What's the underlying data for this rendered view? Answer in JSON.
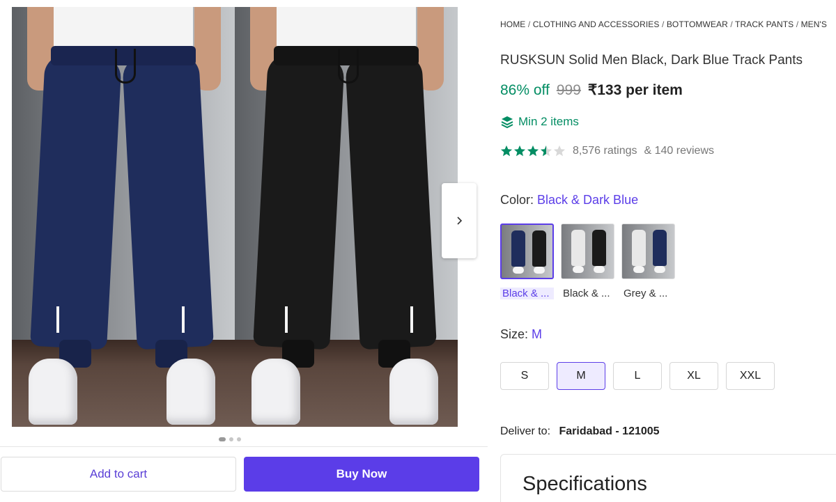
{
  "breadcrumb": {
    "items": [
      "HOME",
      "CLOTHING AND ACCESSORIES",
      "BOTTOMWEAR",
      "TRACK PANTS",
      "MEN'S"
    ],
    "separator": "/"
  },
  "product": {
    "title": "RUSKSUN Solid Men Black, Dark Blue Track Pants",
    "discount": "86% off",
    "mrp": "999",
    "price": "₹133 per item",
    "min_items": "Min 2 items",
    "rating_value": 3.5,
    "ratings": "8,576 ratings",
    "reviews": "& 140 reviews"
  },
  "color": {
    "label": "Color:",
    "selected": "Black & Dark Blue",
    "options": [
      {
        "label": "Black & ...",
        "leg1": "#1f2d5c",
        "leg2": "#1a1a1a"
      },
      {
        "label": "Black & ...",
        "leg1": "#e8e8e8",
        "leg2": "#1a1a1a"
      },
      {
        "label": "Grey & ...",
        "leg1": "#e8e8e8",
        "leg2": "#1f2d5c"
      }
    ]
  },
  "size": {
    "label": "Size:",
    "selected": "M",
    "options": [
      "S",
      "M",
      "L",
      "XL",
      "XXL"
    ]
  },
  "delivery": {
    "label": "Deliver to:",
    "place": "Faridabad - 121005"
  },
  "specifications": {
    "title": "Specifications"
  },
  "actions": {
    "add_to_cart": "Add to cart",
    "buy_now": "Buy Now"
  },
  "gallery": {
    "slides": 3,
    "active_slide": 1
  },
  "colors": {
    "accent": "#5b3de8",
    "green": "#038d63",
    "navy_pant": "#1f2d5c",
    "black_pant": "#1a1a1a"
  }
}
